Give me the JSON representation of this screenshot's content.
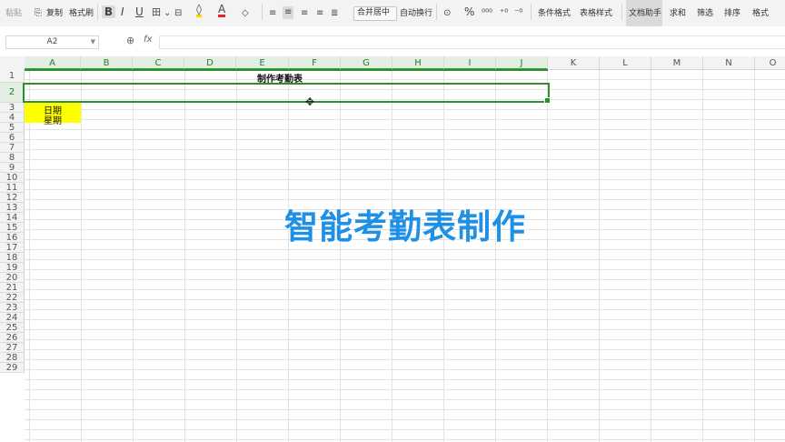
{
  "ribbon": {
    "paste": "粘贴",
    "copy": "复制",
    "format_painter": "格式刷",
    "merge_center": "合并居中",
    "wrap_text": "自动换行",
    "conditional_format": "条件格式",
    "table_style": "表格样式",
    "doc_helper": "文档助手",
    "sum": "求和",
    "filter": "筛选",
    "sort": "排序",
    "format": "格式",
    "font_color": "#e0262b",
    "highlight_color": "#ffd400"
  },
  "formula_bar": {
    "name_box": "A2",
    "fx": "fx",
    "zoom_symbol": "⊕",
    "formula_value": ""
  },
  "columns": [
    "A",
    "B",
    "C",
    "D",
    "E",
    "F",
    "G",
    "H",
    "I",
    "J",
    "K",
    "L",
    "M",
    "N",
    "O"
  ],
  "rows": [
    "1",
    "2",
    "3",
    "4",
    "5",
    "6",
    "7",
    "8",
    "9",
    "10",
    "11",
    "12",
    "13",
    "14",
    "15",
    "16",
    "17",
    "18",
    "19",
    "20",
    "21",
    "22",
    "23",
    "24",
    "25",
    "26",
    "27",
    "28",
    "29"
  ],
  "sheet": {
    "title_cell": "制作考勤表",
    "a3": "日期",
    "a4": "星期",
    "highlight_color": "#ffff00",
    "selection_color": "#2f8f2f"
  },
  "overlay_caption": "智能考勤表制作",
  "overlay_color": "#1e90e6"
}
